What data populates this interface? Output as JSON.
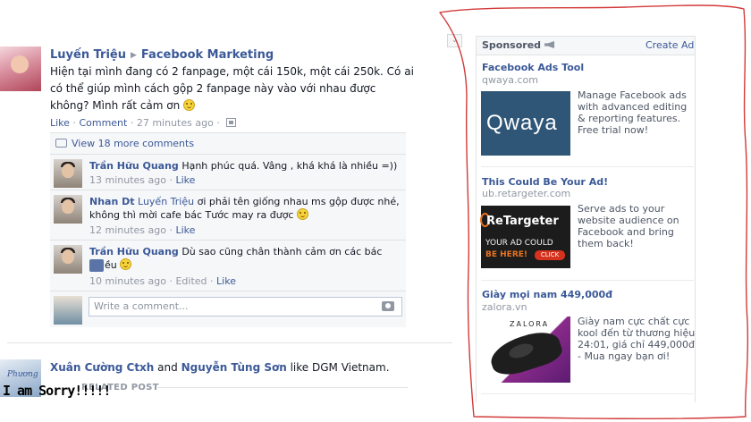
{
  "post": {
    "author": "Luyến Triệu",
    "target": "Facebook Marketing",
    "text": "Hiện tại mình đang có 2 fanpage, một cái 150k, một cái 250k. Có ai có thể giúp mình cách gộp 2 fanpage này vào với nhau được không? Mình rất cảm ơn",
    "actions": {
      "like": "Like",
      "comment": "Comment",
      "time": "27 minutes ago"
    },
    "icons": {
      "emoticon": "smiley-icon",
      "privacy": "photo-gallery-icon",
      "arrow": "triangle-right-icon"
    }
  },
  "comments": {
    "view_more": "View 18 more comments",
    "items": [
      {
        "author": "Trần Hữu Quang",
        "tag": "",
        "text": "Hạnh phúc quá. Vâng , khá khá là nhiều =))",
        "time": "13 minutes ago",
        "like": "Like",
        "edited": ""
      },
      {
        "author": "Nhan Dt",
        "tag": "Luyến Triệu",
        "text": "ơi phải tên giống nhau ms gộp được nhé, không thì mời cafe bác Tước may ra được",
        "time": "12 minutes ago",
        "like": "Like",
        "edited": ""
      },
      {
        "author": "Trần Hữu Quang",
        "tag": "",
        "text": "Dù sao cũng chân thành cảm ơn các bác nhiều",
        "time": "10 minutes ago",
        "like": "Like",
        "edited": "Edited"
      }
    ],
    "write_placeholder": "Write a comment..."
  },
  "story2": {
    "actor1": "Xuân Cường Ctxh",
    "conj": "and",
    "actor2": "Nguyễn Tùng Sơn",
    "verb": "like DGM Vietnam.",
    "related": "RELATED POST",
    "overlay": "I am Sorry!!!!!"
  },
  "sponsored": {
    "title": "Sponsored",
    "create_ad": "Create Ad",
    "ads": [
      {
        "title": "Facebook Ads Tool",
        "domain": "qwaya.com",
        "image_text": "Qwaya",
        "body": "Manage Facebook ads with advanced editing & reporting features. Free trial now!"
      },
      {
        "title": "This Could Be Your Ad!",
        "domain": "ub.retargeter.com",
        "image_logo": "ReTargeter",
        "image_line1": "YOUR AD COULD",
        "image_line2": "BE HERE!",
        "image_button": "CLICK",
        "body": "Serve ads to your website audience on Facebook and bring them back!"
      },
      {
        "title": "Giày mọi nam 449,000đ",
        "domain": "zalora.vn",
        "image_text": "ZALORA",
        "body": "Giày nam cực chất cực kool đến từ thương hiệu 24:01, giá chỉ 449,000đ - Mua ngay bạn ơi!"
      }
    ]
  },
  "colors": {
    "link": "#3b5998",
    "meta": "#9197a3",
    "annotation": "#d23a3a"
  }
}
